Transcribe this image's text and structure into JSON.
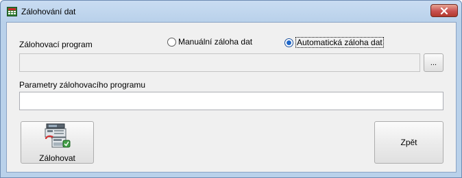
{
  "window": {
    "title": "Zálohování dat",
    "close_icon": "close-icon"
  },
  "backup_program": {
    "label": "Zálohovací program",
    "path_value": "",
    "browse_label": "..."
  },
  "backup_mode": {
    "options": [
      {
        "label": "Manuální záloha dat",
        "checked": false
      },
      {
        "label": "Automatická záloha dat",
        "checked": true
      }
    ]
  },
  "parameters": {
    "label": "Parametry zálohovacího programu",
    "value": ""
  },
  "buttons": {
    "backup_label": "Zálohovat",
    "backup_icon": "backup-computer-icon",
    "back_label": "Zpět"
  },
  "colors": {
    "frame": "#b9d1ea",
    "client": "#f0f0f0",
    "close": "#c75050",
    "radio_selected": "#1f67c9"
  }
}
